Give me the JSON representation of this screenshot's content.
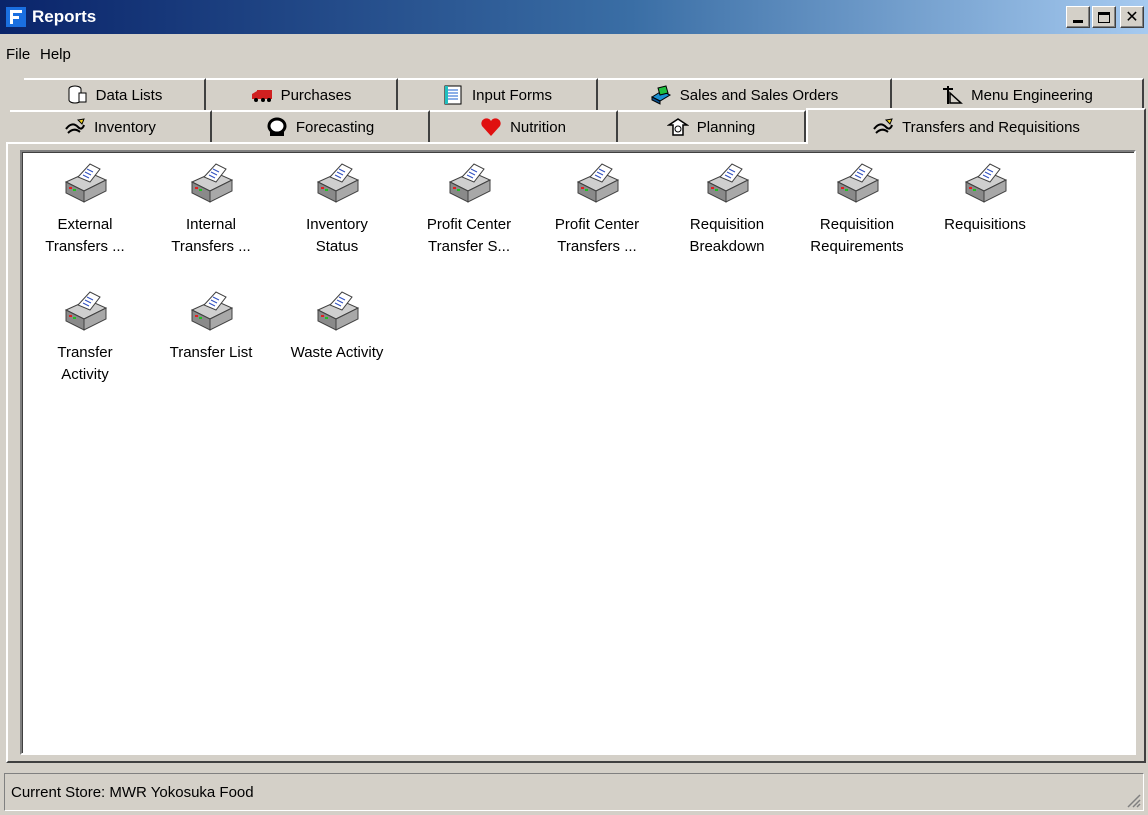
{
  "window": {
    "title": "Reports"
  },
  "menu": {
    "file": "File",
    "help": "Help"
  },
  "tabs_row1": [
    {
      "label": "Data Lists",
      "icon": "data-lists-icon"
    },
    {
      "label": "Purchases",
      "icon": "truck-icon"
    },
    {
      "label": "Input Forms",
      "icon": "input-forms-icon"
    },
    {
      "label": "Sales and Sales Orders",
      "icon": "sales-icon"
    },
    {
      "label": "Menu Engineering",
      "icon": "drafting-icon"
    }
  ],
  "tabs_row2": [
    {
      "label": "Inventory",
      "icon": "inventory-icon"
    },
    {
      "label": "Forecasting",
      "icon": "forecasting-icon"
    },
    {
      "label": "Nutrition",
      "icon": "heart-icon"
    },
    {
      "label": "Planning",
      "icon": "planning-icon"
    },
    {
      "label": "Transfers and Requisitions",
      "icon": "transfers-icon",
      "active": true
    }
  ],
  "reports": [
    {
      "line1": "External",
      "line2": "Transfers ...",
      "icon": "printer-report-icon"
    },
    {
      "line1": "Internal",
      "line2": "Transfers ...",
      "icon": "printer-report-icon"
    },
    {
      "line1": "Inventory",
      "line2": "Status",
      "icon": "printer-report-icon"
    },
    {
      "line1": "Profit Center",
      "line2": "Transfer S...",
      "icon": "printer-report-icon"
    },
    {
      "line1": "Profit Center",
      "line2": "Transfers ...",
      "icon": "printer-report-icon"
    },
    {
      "line1": "Requisition",
      "line2": "Breakdown",
      "icon": "printer-report-icon"
    },
    {
      "line1": "Requisition",
      "line2": "Requirements",
      "icon": "printer-report-icon"
    },
    {
      "line1": "Requisitions",
      "line2": "",
      "icon": "printer-report-icon"
    },
    {
      "line1": "Transfer",
      "line2": "Activity",
      "icon": "printer-report-icon"
    },
    {
      "line1": "Transfer List",
      "line2": "",
      "icon": "printer-report-icon"
    },
    {
      "line1": "Waste Activity",
      "line2": "",
      "icon": "printer-report-icon"
    }
  ],
  "status": {
    "text": "Current Store: MWR Yokosuka Food"
  },
  "colors": {
    "title_start": "#0a246a",
    "title_end": "#a6caf0",
    "face": "#d4d0c8"
  }
}
